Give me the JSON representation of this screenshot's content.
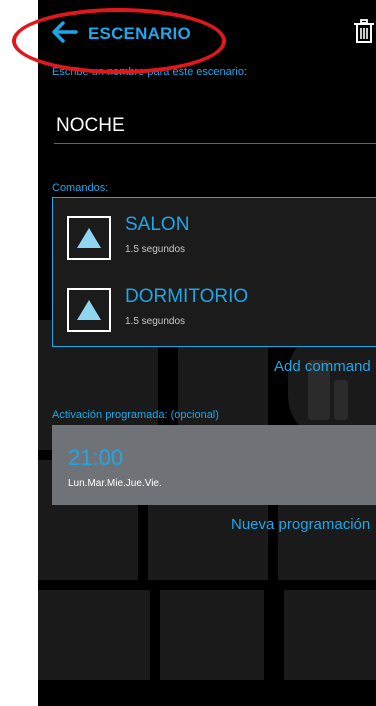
{
  "header": {
    "title": "ESCENARIO",
    "back_icon": "arrow-left-icon",
    "trash_icon": "trash-icon"
  },
  "name_section": {
    "prompt": "Escribe un nombre para este escenario:",
    "value": "NOCHE"
  },
  "commands": {
    "label": "Comandos:",
    "items": [
      {
        "name": "SALON",
        "duration": "1.5 segundos",
        "icon": "device-icon"
      },
      {
        "name": "DORMITORIO",
        "duration": "1.5 segundos",
        "icon": "device-icon"
      }
    ],
    "add_label": "Add command"
  },
  "schedule": {
    "label": "Activación programada: (opcional)",
    "time": "21:00",
    "days": "Lun.Mar.Mie.Jue.Vie.",
    "new_label": "Nueva programación"
  },
  "colors": {
    "accent": "#1ea7e8",
    "background": "#000000",
    "schedule_card": "#6f7378",
    "annotation": "#e1181b"
  }
}
